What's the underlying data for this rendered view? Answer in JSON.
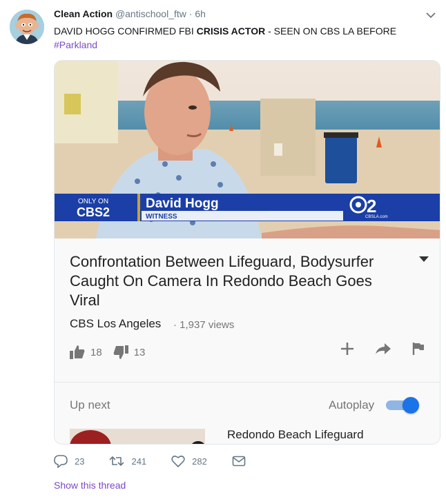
{
  "tweet": {
    "author_name": "Clean Action",
    "handle": "@antischool_ftw",
    "dot": "·",
    "time": "6h",
    "text_part1": "DAVID HOGG CONFIRMED FBI ",
    "text_bold": "CRISIS ACTOR",
    "text_part2": " - SEEN ON CBS LA BEFORE",
    "hashtag": "#Parkland",
    "show_thread": "Show this thread"
  },
  "video": {
    "badge_only_on": "ONLY ON",
    "badge_cbs2": "CBS2",
    "lower_third_name": "David Hogg",
    "lower_third_role": "WITNESS",
    "station_logo": "2",
    "station_url": "CBSLA.com"
  },
  "card": {
    "title": "Confrontation Between Lifeguard, Bodysurfer Caught On Camera In Redondo Beach Goes Viral",
    "channel": "CBS Los Angeles",
    "views": "· 1,937 views",
    "likes": "18",
    "dislikes": "13",
    "up_next_label": "Up next",
    "autoplay_label": "Autoplay",
    "autoplay_on": true,
    "next_video_title": "Redondo Beach Lifeguard"
  },
  "stats": {
    "replies": "23",
    "retweets": "241",
    "likes": "282"
  },
  "colors": {
    "link_purple": "#794bc4",
    "cbs_blue": "#1b3fa6",
    "toggle_blue": "#1a73e8"
  }
}
